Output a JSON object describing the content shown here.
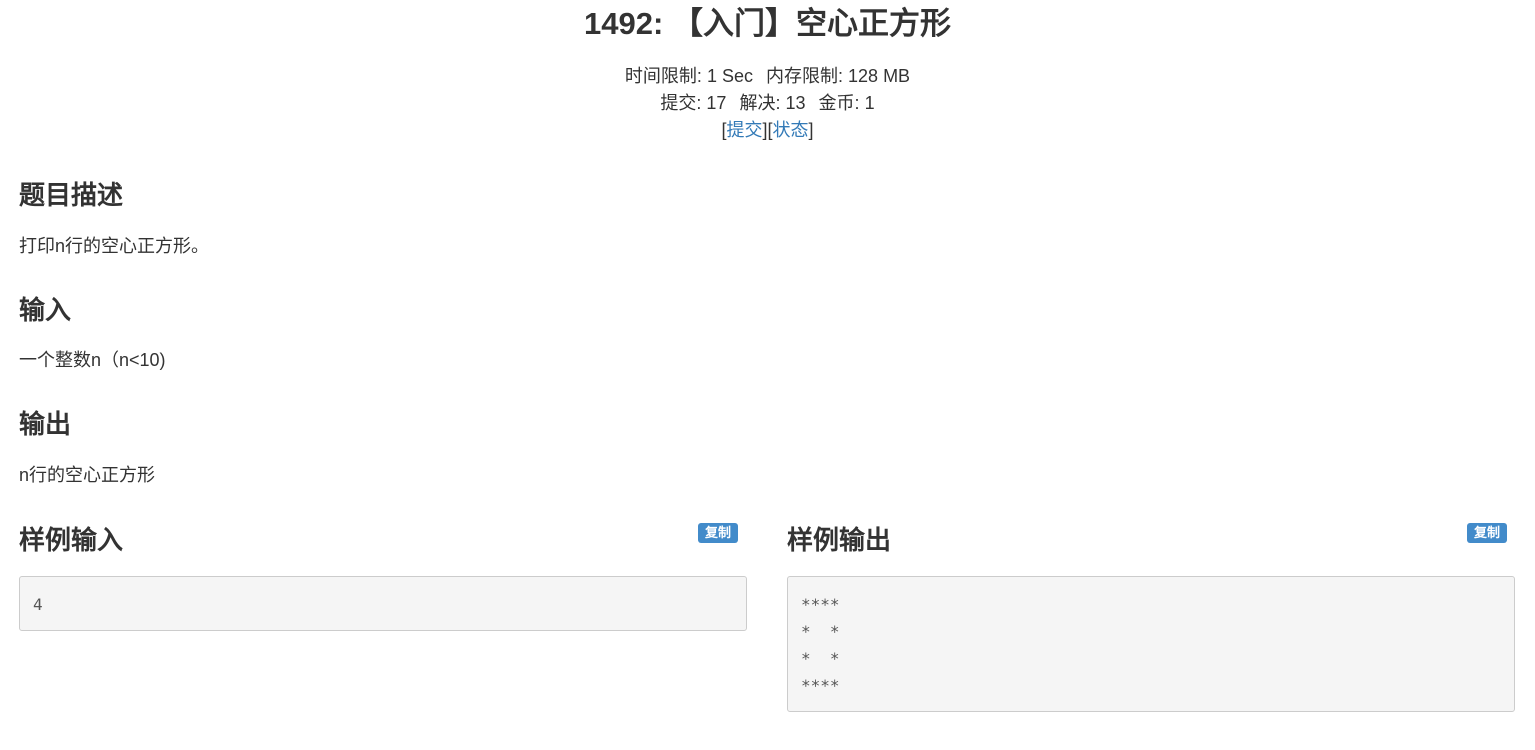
{
  "problem": {
    "title": "1492: 【入门】空心正方形",
    "limits": {
      "time_label": "时间限制:",
      "time_value": "1 Sec",
      "memory_label": "内存限制:",
      "memory_value": "128 MB"
    },
    "stats": {
      "submit_label": "提交:",
      "submit_value": "17",
      "solved_label": "解决:",
      "solved_value": "13",
      "coin_label": "金币:",
      "coin_value": "1"
    },
    "links": {
      "submit": "提交",
      "status": "状态"
    }
  },
  "sections": {
    "description": {
      "heading": "题目描述",
      "text": "打印n行的空心正方形。"
    },
    "input": {
      "heading": "输入",
      "text": "一个整数n（n<10)"
    },
    "output": {
      "heading": "输出",
      "text": "n行的空心正方形"
    }
  },
  "samples": {
    "input": {
      "heading": "样例输入",
      "copy_label": "复制",
      "content": "4"
    },
    "output": {
      "heading": "样例输出",
      "copy_label": "复制",
      "content": "****\n*  *\n*  *\n****"
    }
  }
}
